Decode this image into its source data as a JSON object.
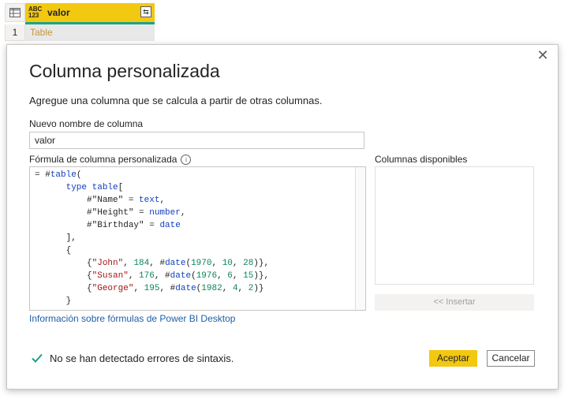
{
  "grid": {
    "column_type_top": "ABC",
    "column_type_bottom": "123",
    "column_name": "valor",
    "row_number": "1",
    "cell_value": "Table",
    "accent_color": "#f2c811",
    "quality_color": "#1aa387"
  },
  "dialog": {
    "title": "Columna personalizada",
    "subtitle": "Agregue una columna que se calcula a partir de otras columnas.",
    "name_label": "Nuevo nombre de columna",
    "name_value": "valor",
    "formula_label": "Fórmula de columna personalizada",
    "formula_lines": [
      "= #table(",
      "      type table[",
      "          #\"Name\" = text,",
      "          #\"Height\" = number,",
      "          #\"Birthday\" = date",
      "      ],",
      "      {",
      "          {\"John\", 184, #date(1970, 10, 28)},",
      "          {\"Susan\", 176, #date(1976, 6, 15)},",
      "          {\"George\", 195, #date(1982, 4, 2)}",
      "      }"
    ],
    "available_columns_label": "Columnas disponibles",
    "available_columns": [],
    "insert_button": "<< Insertar",
    "help_link": "Información sobre fórmulas de Power BI Desktop",
    "status_text": "No se han detectado errores de sintaxis.",
    "ok_button": "Aceptar",
    "cancel_button": "Cancelar",
    "status_color": "#1aa387"
  }
}
